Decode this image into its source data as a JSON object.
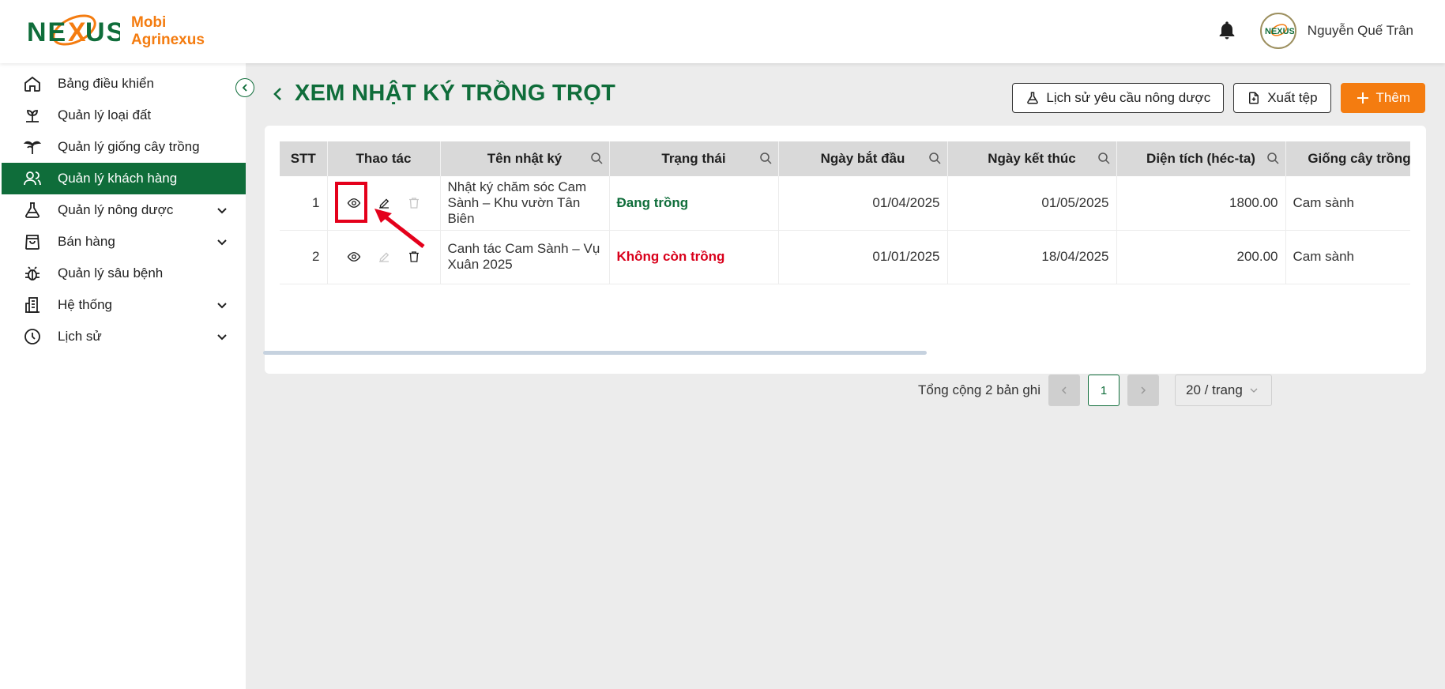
{
  "brand": {
    "logo_word": "NEXUS",
    "line1": "Mobi",
    "line2": "Agrinexus",
    "accent": "#f47c10",
    "primary": "#0f6d3a"
  },
  "user": {
    "name": "Nguyễn Quế Trân",
    "avatar_text": "NEXUS"
  },
  "sidebar": {
    "items": [
      {
        "label": "Bảng điều khiển",
        "icon": "home-icon"
      },
      {
        "label": "Quản lý loại đất",
        "icon": "sprout-icon"
      },
      {
        "label": "Quản lý giống cây trồng",
        "icon": "plant-icon"
      },
      {
        "label": "Quản lý khách hàng",
        "icon": "users-icon",
        "active": true
      },
      {
        "label": "Quản lý nông dược",
        "icon": "flask-icon",
        "expandable": true
      },
      {
        "label": "Bán hàng",
        "icon": "shopping-bag-icon",
        "expandable": true
      },
      {
        "label": "Quản lý sâu bệnh",
        "icon": "bug-icon"
      },
      {
        "label": "Hệ thống",
        "icon": "building-icon",
        "expandable": true
      },
      {
        "label": "Lịch sử",
        "icon": "clock-icon",
        "expandable": true
      }
    ]
  },
  "page": {
    "title": "XEM NHẬT KÝ TRỒNG TRỌT"
  },
  "actions": {
    "history": "Lịch sử yêu cầu nông dược",
    "export": "Xuất tệp",
    "add": "Thêm"
  },
  "table": {
    "columns": [
      "STT",
      "Thao tác",
      "Tên nhật ký",
      "Trạng thái",
      "Ngày bắt đầu",
      "Ngày kết thúc",
      "Diện tích (héc-ta)",
      "Giống cây trồng"
    ],
    "rows": [
      {
        "stt": "1",
        "name": "Nhật ký chăm sóc Cam Sành – Khu vườn Tân Biên",
        "status": "Đang trồng",
        "status_kind": "active",
        "start": "01/04/2025",
        "end": "01/05/2025",
        "area": "1800.00",
        "variety": "Cam sành"
      },
      {
        "stt": "2",
        "name": "Canh tác Cam Sành – Vụ Xuân 2025",
        "status": "Không còn trồng",
        "status_kind": "inactive",
        "start": "01/01/2025",
        "end": "18/04/2025",
        "area": "200.00",
        "variety": "Cam sành"
      }
    ]
  },
  "pagination": {
    "total_text": "Tổng cộng 2 bản ghi",
    "current_page": "1",
    "page_size": "20 / trang"
  }
}
